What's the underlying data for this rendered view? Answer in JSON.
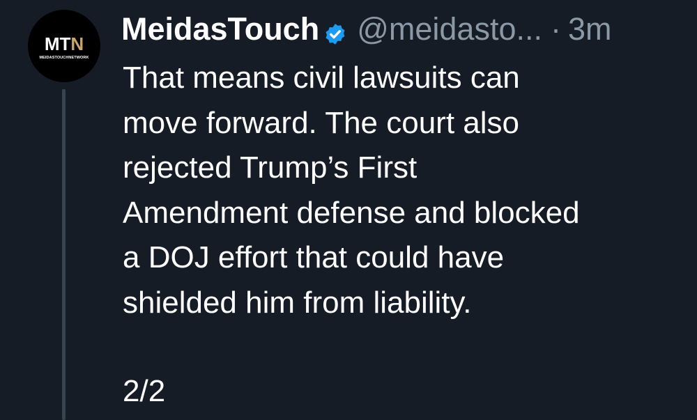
{
  "author": {
    "avatar_logo_left": "MT",
    "avatar_logo_right": "N",
    "avatar_subtext": "MEIDASTOUCHNETWORK",
    "display_name": "MeidasTouch",
    "handle": "@meidasto...",
    "separator": "·",
    "timestamp": "3m",
    "verified_color": "#1d9bf0"
  },
  "tweet": {
    "lines": [
      "That means civil lawsuits can",
      "move forward. The court also",
      "rejected Trump’s First",
      "Amendment defense and blocked",
      "a DOJ effort that could have",
      "shielded him from liability."
    ],
    "thread_count": "2/2"
  },
  "colors": {
    "background": "#161c26",
    "text": "#ffffff",
    "secondary_text": "#8b98a5",
    "thread_line": "#39434f",
    "logo_gold": "#c9a56a"
  }
}
